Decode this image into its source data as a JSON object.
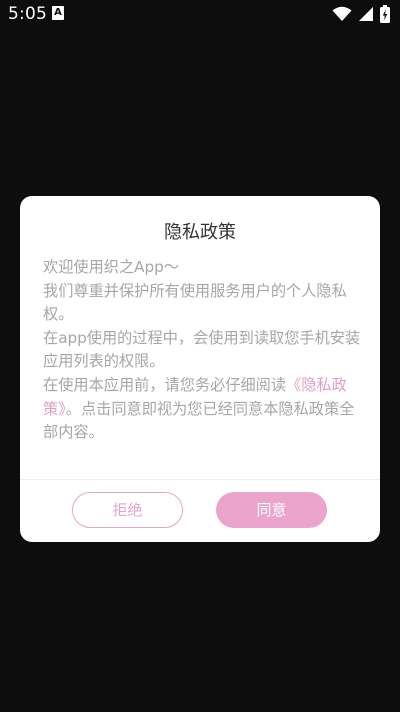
{
  "status_bar": {
    "time": "5:05",
    "notification_icon": "A",
    "icons": [
      "wifi-icon",
      "signal-icon",
      "battery-icon"
    ]
  },
  "dialog": {
    "title": "隐私政策",
    "greeting": "欢迎使用织之App～",
    "paragraph1": "我们尊重并保护所有使用服务用户的个人隐私权。",
    "paragraph2": "在app使用的过程中，会使用到读取您手机安装应用列表的权限。",
    "paragraph3_before": "在使用本应用前，请您务必仔细阅读",
    "policy_link": "《隐私政策》",
    "paragraph3_after": "。点击同意即视为您已经同意本隐私政策全部内容。",
    "reject_label": "拒绝",
    "agree_label": "同意"
  },
  "colors": {
    "accent": "#eba5cc",
    "link": "#e39dc5",
    "background": "#0d0d0d",
    "body_text": "#a6a6a6"
  }
}
